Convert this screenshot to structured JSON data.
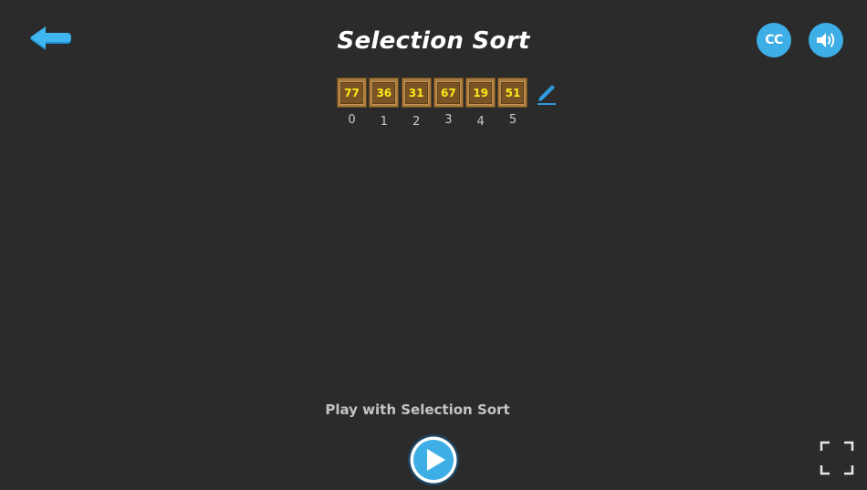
{
  "title": "Selection Sort",
  "header": {
    "back_icon": "back-arrow-icon",
    "cc_label": "CC",
    "sound_icon": "speaker-icon"
  },
  "array": {
    "values": [
      "77",
      "36",
      "31",
      "67",
      "19",
      "51"
    ],
    "indices": [
      "0",
      "1",
      "2",
      "3",
      "4",
      "5"
    ],
    "edit_icon": "pencil-icon"
  },
  "footer": {
    "play_label": "Play with Selection Sort",
    "play_icon": "play-icon",
    "fullscreen_icon": "fullscreen-icon"
  },
  "colors": {
    "background": "#2b2b2b",
    "accent": "#3daee6",
    "cell_fill": "#a87a3c",
    "cell_value": "#ffe81a"
  }
}
